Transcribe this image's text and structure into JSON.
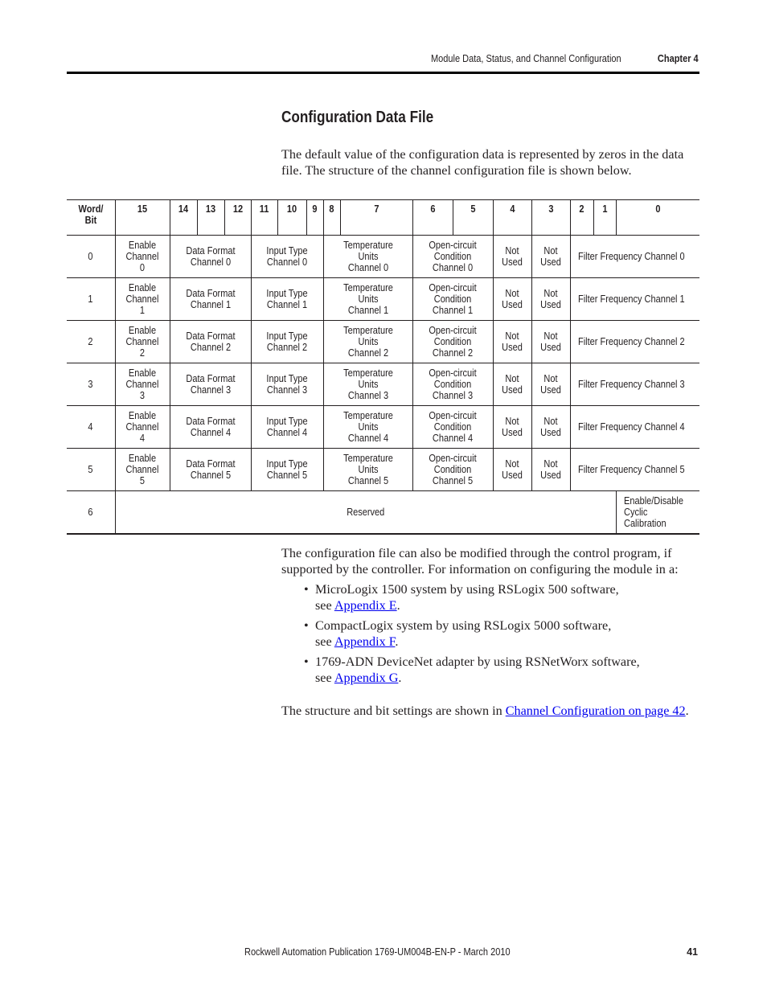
{
  "header": {
    "section": "Module Data, Status, and Channel Configuration",
    "chapter": "Chapter 4"
  },
  "title": "Configuration Data File",
  "intro": "The default value of the configuration data is represented by zeros in the data file. The structure of the channel configuration file is shown below.",
  "table": {
    "headers": [
      "Word/ Bit",
      "15",
      "14",
      "13",
      "12",
      "11",
      "10",
      "9",
      "8",
      "7",
      "6",
      "5",
      "4",
      "3",
      "2",
      "1",
      "0"
    ],
    "rows": [
      {
        "word": "0",
        "enable": "Enable Channel 0",
        "format": "Data Format Channel 0",
        "input": "Input Type Channel 0",
        "temp": "Temperature Units Channel 0",
        "open": "Open-circuit Condition Channel 0",
        "nu4": "Not Used",
        "nu3": "Not Used",
        "filter": "Filter Frequency Channel 0"
      },
      {
        "word": "1",
        "enable": "Enable Channel 1",
        "format": "Data Format Channel 1",
        "input": "Input Type Channel 1",
        "temp": "Temperature Units Channel 1",
        "open": "Open-circuit Condition Channel 1",
        "nu4": "Not Used",
        "nu3": "Not Used",
        "filter": "Filter Frequency Channel 1"
      },
      {
        "word": "2",
        "enable": "Enable Channel 2",
        "format": "Data Format Channel 2",
        "input": "Input Type Channel 2",
        "temp": "Temperature Units Channel 2",
        "open": "Open-circuit Condition Channel 2",
        "nu4": "Not Used",
        "nu3": "Not Used",
        "filter": "Filter Frequency Channel 2"
      },
      {
        "word": "3",
        "enable": "Enable Channel 3",
        "format": "Data Format Channel 3",
        "input": "Input Type Channel 3",
        "temp": "Temperature Units Channel 3",
        "open": "Open-circuit Condition Channel 3",
        "nu4": "Not Used",
        "nu3": "Not Used",
        "filter": "Filter Frequency Channel 3"
      },
      {
        "word": "4",
        "enable": "Enable Channel 4",
        "format": "Data Format Channel 4",
        "input": "Input Type Channel 4",
        "temp": "Temperature Units Channel 4",
        "open": "Open-circuit Condition Channel 4",
        "nu4": "Not Used",
        "nu3": "Not Used",
        "filter": "Filter Frequency Channel 4"
      },
      {
        "word": "5",
        "enable": "Enable Channel 5",
        "format": "Data Format Channel 5",
        "input": "Input Type Channel 5",
        "temp": "Temperature Units Channel 5",
        "open": "Open-circuit Condition Channel 5",
        "nu4": "Not Used",
        "nu3": "Not Used",
        "filter": "Filter Frequency Channel 5"
      }
    ],
    "last_row": {
      "word": "6",
      "reserved": "Reserved",
      "calibration": "Enable/Disable Cyclic Calibration"
    }
  },
  "after_table": "The configuration file can also be modified through the control program, if supported by the controller. For information on configuring the module in a:",
  "bullets": [
    {
      "text": "MicroLogix 1500 system by using RSLogix 500 software,",
      "see": "see ",
      "link": "Appendix E",
      "end": "."
    },
    {
      "text": "CompactLogix system by using RSLogix 5000 software,",
      "see": "see ",
      "link": "Appendix F",
      "end": "."
    },
    {
      "text": "1769-ADN DeviceNet adapter by using RSNetWorx software,",
      "see": "see ",
      "link": "Appendix G",
      "end": "."
    }
  ],
  "structure": {
    "text": "The structure and bit settings are shown in ",
    "link": "Channel Configuration on page 42",
    "end": "."
  },
  "footer": {
    "publication": "Rockwell Automation Publication 1769-UM004B-EN-P - March 2010",
    "page": "41"
  },
  "colors": {
    "link": "#0000ee",
    "text": "#231f20"
  }
}
